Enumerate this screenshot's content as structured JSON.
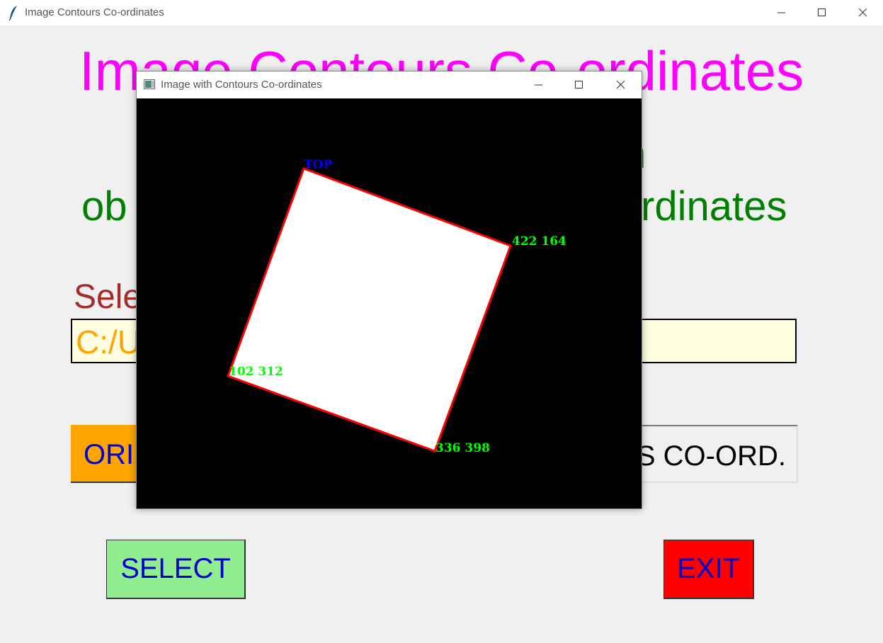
{
  "window": {
    "title": "Image Contours Co-ordinates",
    "icon": "feather-icon"
  },
  "main": {
    "heading": "Image Contours Co-ordinates",
    "subtitle_line1_visible": "h",
    "subtitle_line2_left": "ob",
    "subtitle_line2_right": "rdinates",
    "select_label_visible": "Sele",
    "path_value_visible": "C:/U",
    "original_button_visible": "ORI",
    "contours_button_visible": "S CO-ORD.",
    "select_button": "SELECT",
    "exit_button": "EXIT"
  },
  "popup": {
    "title": "Image with Contours Co-ordinates",
    "icon": "image-window-icon",
    "labels": {
      "top": "TOP",
      "corner_right": "422 164",
      "corner_left": "102 312",
      "corner_bottom": "336 398"
    }
  },
  "colors": {
    "heading": "#ff00ff",
    "subtitle": "#008000",
    "select_label": "#a52a2a",
    "path_text": "#ffa500",
    "path_bg": "#fffee0",
    "original_bg": "#ffa500",
    "select_bg": "#90ee90",
    "exit_bg": "#ff0000",
    "button_text": "#0000cd",
    "contour": "#ff0000",
    "coord_text": "#00ff00",
    "top_text": "#0000ff"
  }
}
